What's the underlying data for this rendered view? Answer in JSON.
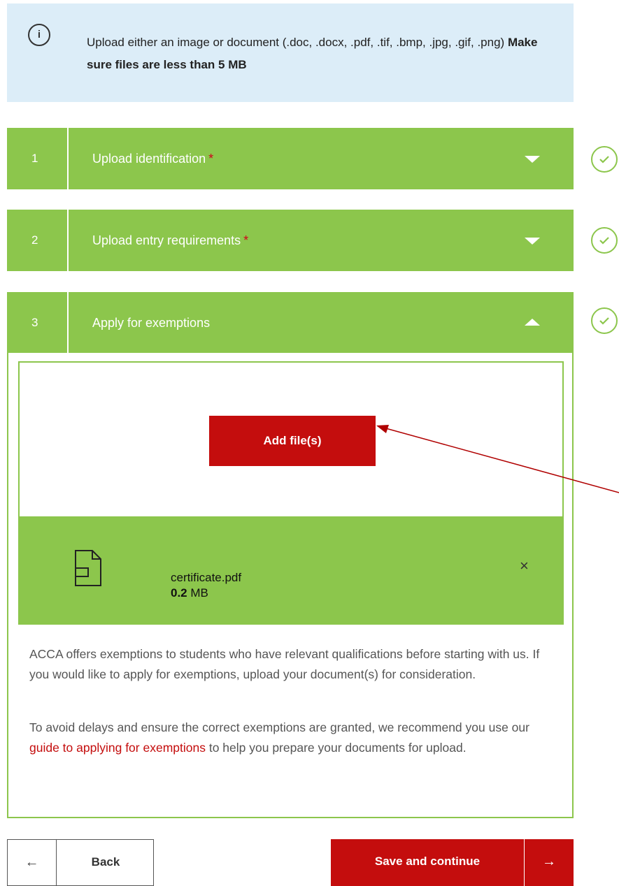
{
  "info": {
    "icon": "info-icon",
    "icon_glyph": "i",
    "text": "Upload either an image or document (.doc, .docx, .pdf, .tif, .bmp, .jpg, .gif, .png)",
    "text_bold": "Make sure files are less than 5 MB"
  },
  "steps": [
    {
      "number": "1",
      "title": "Upload identification",
      "required": "*",
      "state": "collapsed",
      "completed": true
    },
    {
      "number": "2",
      "title": "Upload entry requirements",
      "required": "*",
      "state": "collapsed",
      "completed": true
    },
    {
      "number": "3",
      "title": "Apply for exemptions",
      "required": "",
      "state": "expanded",
      "completed": true
    }
  ],
  "upload": {
    "add_button": "Add file(s)",
    "file": {
      "name": "certificate.pdf",
      "size_value": "0.2",
      "size_unit": "MB",
      "close_glyph": "×"
    }
  },
  "description": {
    "p1": "ACCA offers exemptions to students who have relevant qualifications before starting with us. If you would like to apply for exemptions, upload your document(s) for consideration.",
    "p2_before": "To avoid delays and ensure the correct exemptions are granted, we recommend you use our ",
    "p2_link": "guide to applying for exemptions",
    "p2_after": " to help you prepare your documents for upload."
  },
  "footer": {
    "back_arrow": "←",
    "back_label": "Back",
    "save_label": "Save and continue",
    "save_arrow": "→"
  },
  "colors": {
    "green": "#8cc64c",
    "red": "#c40d0d",
    "info_bg": "#dcedf8",
    "annotation_arrow": "#b00000"
  }
}
